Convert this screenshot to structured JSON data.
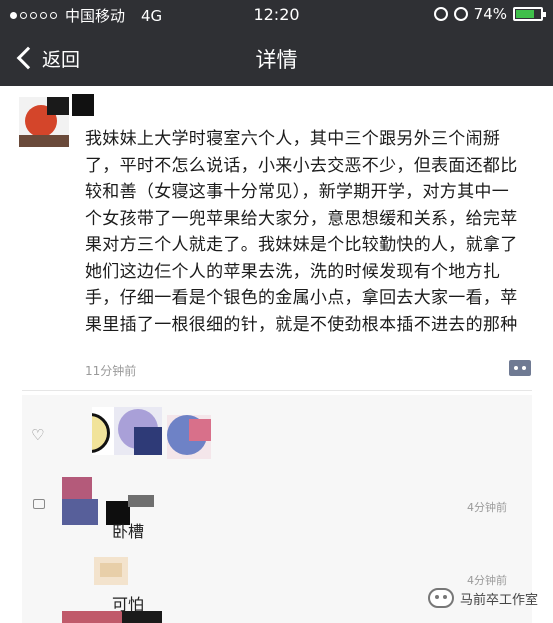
{
  "status_bar": {
    "carrier": "中国移动",
    "network": "4G",
    "time": "12:20",
    "battery": "74%",
    "battery_level": 0.74
  },
  "nav": {
    "back_label": "返回",
    "title": "详情"
  },
  "post": {
    "text": "我妹妹上大学时寝室六个人，其中三个跟另外三个闹掰了，平时不怎么说话，小来小去交恶不少，但表面还都比较和善（女寝这事十分常见），新学期开学，对方其中一个女孩带了一兜苹果给大家分，意思想缓和关系，给完苹果对方三个人就走了。我妹妹是个比较勤快的人，就拿了她们这边仨个人的苹果去洗，洗的时候发现有个地方扎手，仔细一看是个银色的金属小点，拿回去大家一看，苹果里插了一根很细的针，就是不使劲根本插不进去的那种",
    "time": "11分钟前"
  },
  "comments": [
    {
      "text": "卧槽",
      "time": "4分钟前"
    },
    {
      "text": "可怕",
      "time": "4分钟前"
    }
  ],
  "watermark": {
    "text": "马前卒工作室"
  },
  "icons": {
    "back": "chevron-left-icon",
    "like": "heart-icon",
    "comment": "comment-icon",
    "more": "more-icon",
    "alarm": "alarm-icon",
    "lock": "rotation-lock-icon",
    "battery": "battery-icon"
  },
  "colors": {
    "nav_background": "#2f3034",
    "battery_fill": "#3fbf4a",
    "more_button": "#6f7a93"
  }
}
